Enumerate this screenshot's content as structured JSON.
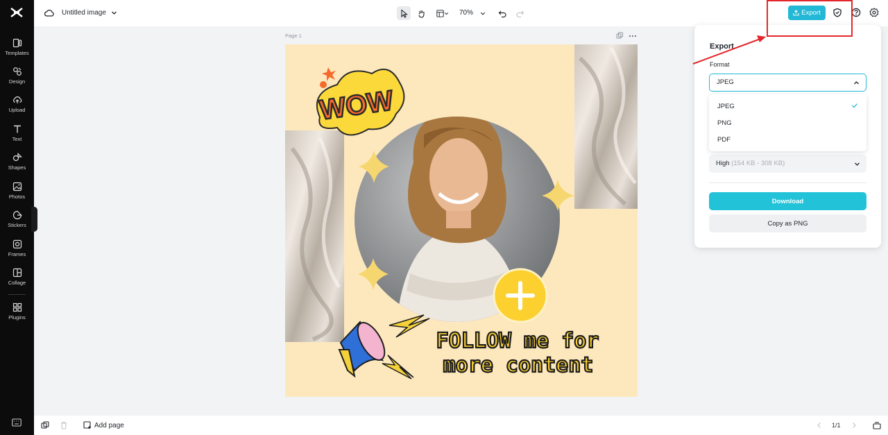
{
  "sidebar": {
    "items": [
      {
        "label": "Templates",
        "icon": "templates-icon"
      },
      {
        "label": "Design",
        "icon": "design-icon"
      },
      {
        "label": "Upload",
        "icon": "upload-icon"
      },
      {
        "label": "Text",
        "icon": "text-icon"
      },
      {
        "label": "Shapes",
        "icon": "shapes-icon"
      },
      {
        "label": "Photos",
        "icon": "photos-icon"
      },
      {
        "label": "Stickers",
        "icon": "stickers-icon"
      },
      {
        "label": "Frames",
        "icon": "frames-icon"
      },
      {
        "label": "Collage",
        "icon": "collage-icon"
      },
      {
        "label": "Plugins",
        "icon": "plugins-icon"
      }
    ]
  },
  "topbar": {
    "title": "Untitled image",
    "zoom": "70%",
    "export_label": "Export"
  },
  "canvas": {
    "page_label": "Page 1",
    "design": {
      "sticker_text": "WOW",
      "headline_line1": "FOLLOW me for",
      "headline_line2": "more content"
    }
  },
  "export_panel": {
    "title": "Export",
    "format_label": "Format",
    "selected_format": "JPEG",
    "format_options": [
      "JPEG",
      "PNG",
      "PDF"
    ],
    "quality_value": "High",
    "quality_detail": "(154 KB - 308 KB)",
    "download_label": "Download",
    "copy_label": "Copy as PNG"
  },
  "bottombar": {
    "add_page_label": "Add page",
    "page_counter": "1/1"
  },
  "colors": {
    "accent": "#22b8d6",
    "highlight": "#e3262b",
    "canvas_bg": "#fde8bd"
  }
}
